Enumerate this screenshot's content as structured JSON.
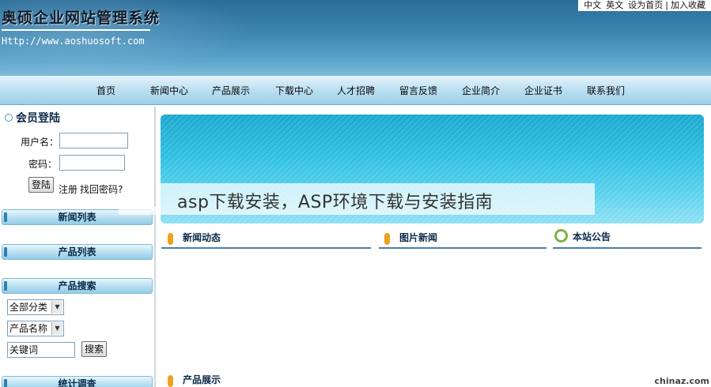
{
  "header": {
    "title": "奥硕企业网站管理系统",
    "url": "Http://www.aoshuosoft.com",
    "top_links": [
      "中文",
      "英文",
      "设为首页",
      "|",
      "加入收藏"
    ]
  },
  "nav": {
    "items": [
      "首页",
      "新闻中心",
      "产品展示",
      "下载中心",
      "人才招聘",
      "留言反馈",
      "企业简介",
      "企业证书",
      "联系我们"
    ]
  },
  "sidebar": {
    "login": {
      "title": "会员登陆",
      "username_label": "用户名：",
      "password_label": "密码：",
      "login_button": "登陆",
      "register_link": "注册",
      "forgot_link": "找回密码?"
    },
    "panels": {
      "news_list": "新闻列表",
      "product_list": "产品列表",
      "product_search": "产品搜索",
      "stats_survey": "统计调查"
    },
    "search": {
      "category_select": "全部分类",
      "field_select": "产品名称",
      "keyword_value": "关键词",
      "search_button": "搜索"
    }
  },
  "main": {
    "overlay_title": "asp下载安装，ASP环境下载与安装指南",
    "sections": {
      "news": "新闻动态",
      "picture_news": "图片新闻",
      "announcement": "本站公告",
      "products": "产品展示"
    }
  },
  "watermark": "chinaz.com",
  "colors": {
    "header_blue": "#3d86b3",
    "nav_light_blue": "#bfe1f2",
    "banner_cyan": "#2fc0e2",
    "accent_orange": "#f0a020",
    "accent_green": "#7cb342",
    "section_line": "#4a7ea6"
  }
}
